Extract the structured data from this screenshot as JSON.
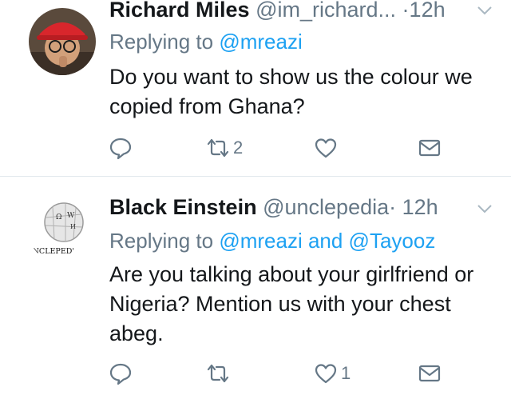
{
  "tweets": [
    {
      "name": "Richard Miles",
      "handle": "@im_richard...",
      "dot": "·",
      "time": "12h",
      "replying_prefix": "Replying to",
      "replying_to": "@mreazi",
      "text": "Do you want to show us the colour we copied from Ghana?",
      "retweets": "2",
      "likes": ""
    },
    {
      "name": "Black Einstein",
      "handle": "@unclepedia",
      "dot": "·",
      "time": "12h",
      "replying_prefix": "Replying to",
      "replying_to": "@mreazi and @Tayooz",
      "text": "Are you talking about your girlfriend or Nigeria? Mention us with your chest abeg.",
      "retweets": "",
      "likes": "1",
      "avatar_caption": "'NCLEPED'"
    }
  ],
  "icons": {
    "reply": "reply-icon",
    "retweet": "retweet-icon",
    "like": "heart-icon",
    "message": "envelope-icon",
    "menu": "chevron-down-icon"
  },
  "colors": {
    "accent": "#1da1f2",
    "muted": "#657786",
    "text": "#14171a",
    "divider": "#e1e8ed"
  }
}
